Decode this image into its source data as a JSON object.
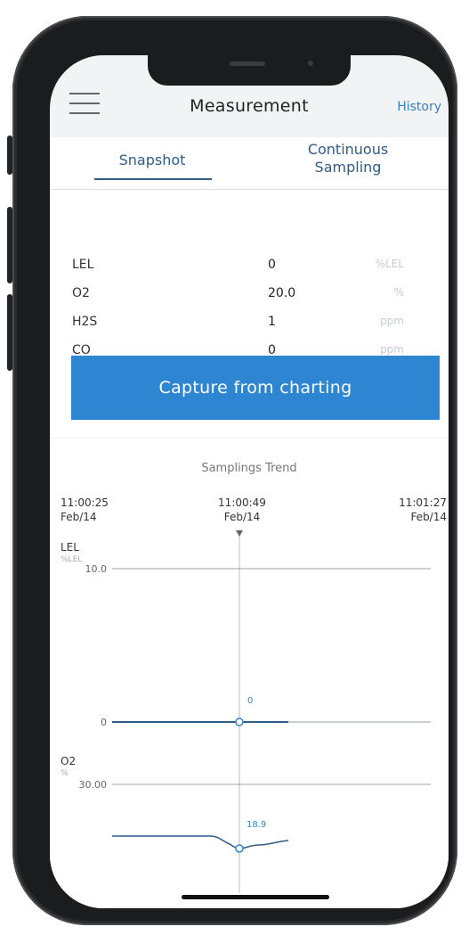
{
  "header": {
    "title": "Measurement",
    "history_label": "History"
  },
  "tabs": [
    {
      "label": "Snapshot",
      "active": true
    },
    {
      "label": "Continuous Sampling",
      "active": false
    }
  ],
  "readings": [
    {
      "name": "LEL",
      "value": "0",
      "unit": "%LEL"
    },
    {
      "name": "O2",
      "value": "20.0",
      "unit": "%"
    },
    {
      "name": "H2S",
      "value": "1",
      "unit": "ppm"
    },
    {
      "name": "CO",
      "value": "0",
      "unit": "ppm"
    }
  ],
  "capture_button": "Capture from charting",
  "trend": {
    "title": "Samplings Trend",
    "times": [
      {
        "time": "11:00:25",
        "date": "Feb/14"
      },
      {
        "time": "11:00:49",
        "date": "Feb/14"
      },
      {
        "time": "11:01:27",
        "date": "Feb/14"
      }
    ],
    "charts": [
      {
        "name": "LEL",
        "unit": "%LEL",
        "top_tick": "10.0",
        "bottom_tick": "0",
        "cursor_value": "0"
      },
      {
        "name": "O2",
        "unit": "%",
        "top_tick": "30.00",
        "cursor_value": "18.9"
      }
    ]
  },
  "colors": {
    "accent": "#2e86d3",
    "tab_text": "#2c5c8c",
    "link": "#3a7fc1"
  }
}
